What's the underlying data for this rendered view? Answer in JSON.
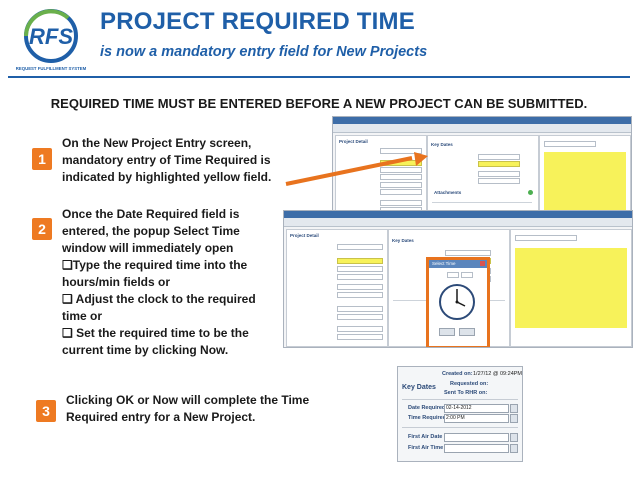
{
  "header": {
    "title": "PROJECT REQUIRED TIME",
    "subtitle": "is now a mandatory entry field for New Projects",
    "logo_text": "RFS",
    "logo_tagline": "REQUEST FULFILLMENT SYSTEM"
  },
  "headline": "REQUIRED TIME MUST BE ENTERED BEFORE A NEW PROJECT CAN BE SUBMITTED.",
  "steps": [
    {
      "number": "1",
      "lines": [
        "On the New Project Entry screen,",
        "mandatory entry of Time Required is",
        "indicated by highlighted yellow field."
      ]
    },
    {
      "number": "2",
      "lines": [
        "Once the Date Required field is",
        "entered, the popup Select Time",
        "window will immediately open",
        "❑Type the required time into the",
        "hours/min fields  or",
        "❑ Adjust the clock to the required",
        "time   or",
        "❑ Set the required time to be the",
        "current time by clicking Now."
      ]
    },
    {
      "number": "3",
      "lines": [
        "Clicking OK or Now will complete the Time",
        "Required entry for a New Project."
      ]
    }
  ],
  "screen1": {
    "project_detail": "Project Detail",
    "key_dates": "Key Dates",
    "attachments": "Attachments"
  },
  "screen2": {
    "project_detail": "Project Detail",
    "key_dates": "Key Dates",
    "popup_title": "Select Time"
  },
  "key_dates_panel": {
    "created_on_label": "Created on:",
    "created_on_value": "1/27/12 @ 09:24PM",
    "section_title": "Key Dates",
    "requested_on_label": "Requested on:",
    "sent_to_label": "Sent To RHR on:",
    "date_required_label": "Date Required",
    "date_required_value": "02-14-2012",
    "time_required_label": "Time Required",
    "time_required_value": "2:00 PM",
    "first_air_date_label": "First Air Date",
    "first_air_time_label": "First Air Time"
  },
  "colors": {
    "brand_blue": "#1f5fa8",
    "badge_orange": "#ee7a22",
    "arrow_orange": "#e8731e",
    "highlight_yellow": "#f7f25a"
  }
}
